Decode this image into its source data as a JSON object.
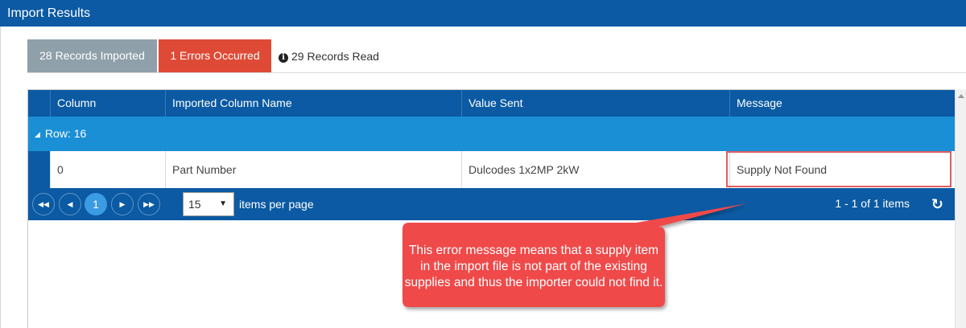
{
  "window": {
    "title": "Import Results"
  },
  "summary": {
    "imported_label": "28 Records Imported",
    "errors_label": "1 Errors Occurred",
    "read_label": "29 Records Read",
    "read_icon": "info-icon"
  },
  "grid": {
    "columns": [
      "Column",
      "Imported Column Name",
      "Value Sent",
      "Message"
    ],
    "group": {
      "label": "Row: 16"
    },
    "rows": [
      {
        "column": "0",
        "imported_column_name": "Part Number",
        "value_sent": "Dulcodes 1x2MP 2kW",
        "message": "Supply Not Found"
      }
    ]
  },
  "pager": {
    "current_page": "1",
    "page_size": "15",
    "items_per_page_label": "items per page",
    "info": "1 - 1 of 1 items"
  },
  "callout": {
    "text": "This error message means that a supply item in the import file is not part of the existing supplies and thus the importer could not find it."
  },
  "colors": {
    "primary": "#0b5aa3",
    "group_row": "#1a8fd6",
    "imported_tab": "#8fa0ab",
    "errors_tab": "#de4a36",
    "callout": "#f04848"
  }
}
